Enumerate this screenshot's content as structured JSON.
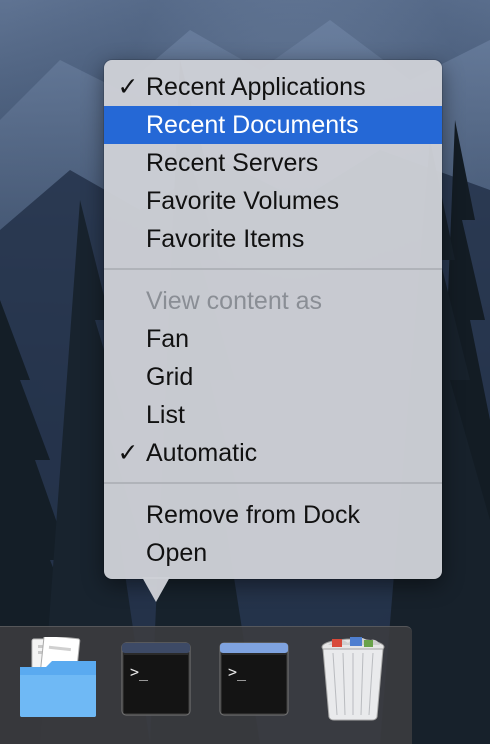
{
  "menu": {
    "items": [
      {
        "label": "Recent Applications",
        "checked": true,
        "selected": false,
        "disabled": false
      },
      {
        "label": "Recent Documents",
        "checked": false,
        "selected": true,
        "disabled": false
      },
      {
        "label": "Recent Servers",
        "checked": false,
        "selected": false,
        "disabled": false
      },
      {
        "label": "Favorite Volumes",
        "checked": false,
        "selected": false,
        "disabled": false
      },
      {
        "label": "Favorite Items",
        "checked": false,
        "selected": false,
        "disabled": false
      }
    ],
    "view_section": {
      "header": "View content as",
      "items": [
        {
          "label": "Fan",
          "checked": false
        },
        {
          "label": "Grid",
          "checked": false
        },
        {
          "label": "List",
          "checked": false
        },
        {
          "label": "Automatic",
          "checked": true
        }
      ]
    },
    "actions": [
      {
        "label": "Remove from Dock"
      },
      {
        "label": "Open"
      }
    ],
    "check_glyph": "✓",
    "selection_color": "#2568d6"
  },
  "dock": {
    "icons": [
      {
        "name": "recent-documents-folder-icon"
      },
      {
        "name": "terminal-icon",
        "prompt": ">_"
      },
      {
        "name": "terminal-icon",
        "prompt": ">_"
      },
      {
        "name": "trash-full-icon"
      }
    ]
  }
}
